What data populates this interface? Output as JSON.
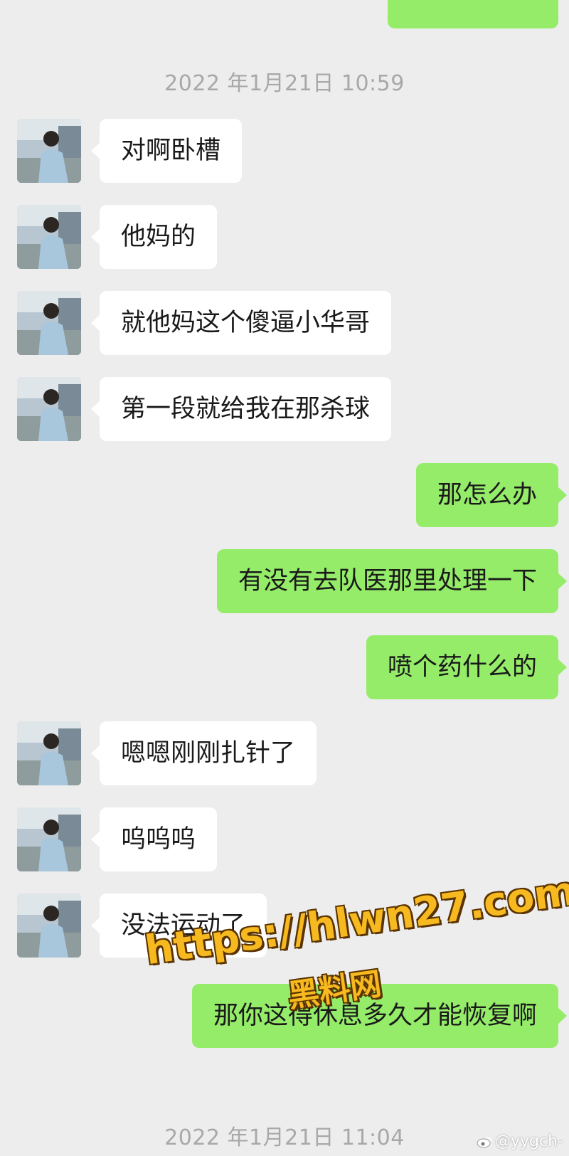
{
  "timestamps": {
    "first": "2022 年1月21日 10:59",
    "second": "2022 年1月21日 11:04"
  },
  "messages": [
    {
      "side": "left",
      "text": "对啊卧槽"
    },
    {
      "side": "left",
      "text": "他妈的"
    },
    {
      "side": "left",
      "text": "就他妈这个傻逼小华哥"
    },
    {
      "side": "left",
      "text": "第一段就给我在那杀球"
    },
    {
      "side": "right",
      "text": "那怎么办"
    },
    {
      "side": "right",
      "text": "有没有去队医那里处理一下"
    },
    {
      "side": "right",
      "text": "喷个药什么的"
    },
    {
      "side": "left",
      "text": "嗯嗯刚刚扎针了"
    },
    {
      "side": "left",
      "text": "呜呜呜"
    },
    {
      "side": "left",
      "text": "没法运动了"
    },
    {
      "side": "right",
      "text": "那你这得休息多久才能恢复啊"
    }
  ],
  "watermark": {
    "url": "https://hlwn27.com",
    "name": "黑料网"
  },
  "weibo_handle": "@yygch-",
  "colors": {
    "background": "#ededed",
    "sent_bubble": "#95ec69",
    "received_bubble": "#ffffff",
    "timestamp": "#a8a8a8"
  }
}
